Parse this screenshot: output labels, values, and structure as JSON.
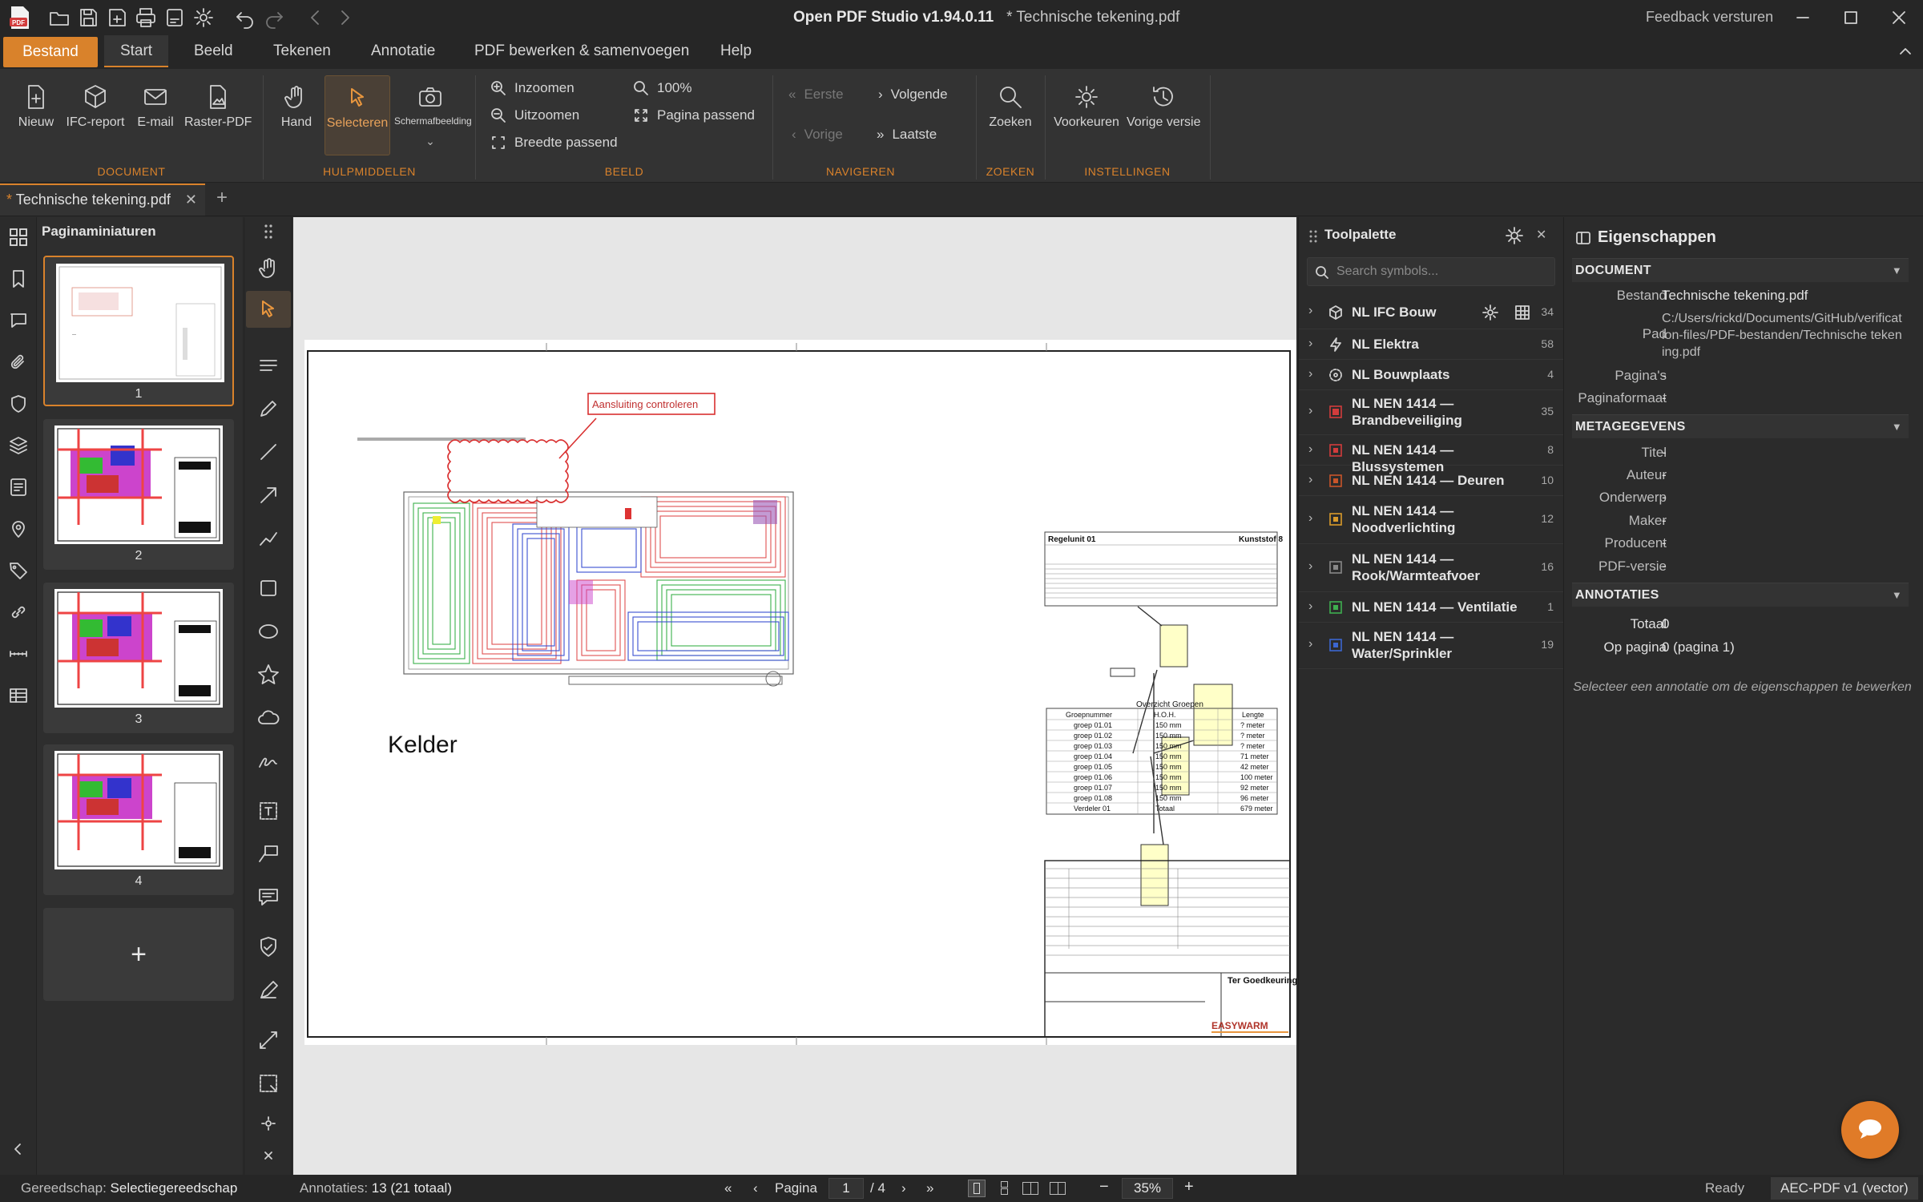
{
  "titlebar": {
    "app_title": "Open PDF Studio v1.94.0.11",
    "doc_title": "* Technische tekening.pdf",
    "feedback": "Feedback versturen"
  },
  "menu": {
    "items": [
      "Bestand",
      "Start",
      "Beeld",
      "Tekenen",
      "Annotatie",
      "PDF bewerken & samenvoegen",
      "Help"
    ]
  },
  "ribbon": {
    "document": {
      "group": "DOCUMENT",
      "nieuw": "Nieuw",
      "ifc": "IFC-report",
      "email": "E-mail",
      "raster": "Raster-PDF"
    },
    "hulp": {
      "group": "HULPMIDDELEN",
      "hand": "Hand",
      "select": "Selecteren",
      "screenshot": "Schermafbeelding"
    },
    "beeld": {
      "group": "BEELD",
      "zoomin": "Inzoomen",
      "zoomout": "Uitzoomen",
      "fitwidth": "Breedte passend",
      "zoom": "100%",
      "fitpage": "Pagina passend"
    },
    "nav": {
      "group": "NAVIGEREN",
      "first": "Eerste",
      "prev": "Vorige",
      "next": "Volgende",
      "last": "Laatste"
    },
    "zoeken": {
      "group": "ZOEKEN",
      "search": "Zoeken"
    },
    "instellingen": {
      "group": "INSTELLINGEN",
      "prefs": "Voorkeuren",
      "prev_version": "Vorige versie"
    }
  },
  "doctab": {
    "label": "Technische tekening.pdf",
    "modified": "*"
  },
  "thumbnails": {
    "title": "Paginaminiaturen",
    "pages": [
      "1",
      "2",
      "3",
      "4"
    ],
    "add": "+"
  },
  "drawing": {
    "label_kelder": "Kelder",
    "callout": "Aansluiting controleren",
    "title_block": "Ter Goedkeuring",
    "regelunit": "Regelunit 01",
    "kunststof": "Kunststof 8",
    "overzicht": "Overzicht Groepen",
    "groups_header": [
      "Groepnummer",
      "H.O.H.",
      "Lengte"
    ],
    "groups": [
      [
        "groep 01.01",
        "150 mm",
        "? meter"
      ],
      [
        "groep 01.02",
        "150 mm",
        "? meter"
      ],
      [
        "groep 01.03",
        "150 mm",
        "? meter"
      ],
      [
        "groep 01.04",
        "150 mm",
        "71 meter"
      ],
      [
        "groep 01.05",
        "150 mm",
        "42 meter"
      ],
      [
        "groep 01.06",
        "150 mm",
        "100 meter"
      ],
      [
        "groep 01.07",
        "150 mm",
        "92 meter"
      ],
      [
        "groep 01.08",
        "150 mm",
        "96 meter"
      ],
      [
        "Verdeler 01",
        "Totaal",
        "679 meter"
      ]
    ],
    "logo": "EASYWARM"
  },
  "toolpalette": {
    "title": "Toolpalette",
    "search_placeholder": "Search symbols...",
    "items": [
      {
        "name": "NL IFC Bouw",
        "count": "34",
        "color": "#d0d0d0"
      },
      {
        "name": "NL Elektra",
        "count": "58",
        "color": "#d0d0d0"
      },
      {
        "name": "NL Bouwplaats",
        "count": "4",
        "color": "#d0d0d0"
      },
      {
        "name": "NL NEN 1414 — Brandbeveiliging",
        "count": "35",
        "color": "#d23c3c"
      },
      {
        "name": "NL NEN 1414 — Blussystemen",
        "count": "8",
        "color": "#d23c3c"
      },
      {
        "name": "NL NEN 1414 — Deuren",
        "count": "10",
        "color": "#c8552a"
      },
      {
        "name": "NL NEN 1414 — Noodverlichting",
        "count": "12",
        "color": "#d99a2b"
      },
      {
        "name": "NL NEN 1414 — Rook/Warmteafvoer",
        "count": "16",
        "color": "#888888"
      },
      {
        "name": "NL NEN 1414 — Ventilatie",
        "count": "1",
        "color": "#3fae4f"
      },
      {
        "name": "NL NEN 1414 — Water/Sprinkler",
        "count": "19",
        "color": "#3b66d0"
      }
    ]
  },
  "properties": {
    "title": "Eigenschappen",
    "document": {
      "header": "DOCUMENT",
      "bestand_label": "Bestand",
      "bestand": "Technische tekening.pdf",
      "pad_label": "Pad",
      "pad": "C:/Users/rickd/Documents/GitHub/verification-files/PDF-bestanden/Technische tekening.pdf",
      "paginas_label": "Pagina's",
      "paginas": "-",
      "formaat_label": "Paginaformaat",
      "formaat": "-"
    },
    "meta": {
      "header": "METAGEGEVENS",
      "titel_label": "Titel",
      "titel": "-",
      "auteur_label": "Auteur",
      "auteur": "-",
      "onderwerp_label": "Onderwerp",
      "onderwerp": "-",
      "maker_label": "Maker",
      "maker": "-",
      "producent_label": "Producent",
      "producent": "-",
      "versie_label": "PDF-versie",
      "versie": "-"
    },
    "annot": {
      "header": "ANNOTATIES",
      "totaal_label": "Totaal",
      "totaal": "0",
      "oppagina_label": "Op pagina",
      "oppagina": "0 (pagina 1)",
      "hint": "Selecteer een annotatie om de eigenschappen te bewerken"
    }
  },
  "status": {
    "tool_label": "Gereedschap:",
    "tool": "Selectiegereedschap",
    "annot_label": "Annotaties:",
    "annot": "13 (21 totaal)",
    "page_label": "Pagina",
    "page": "1",
    "page_total": "/ 4",
    "zoom": "35%",
    "ready": "Ready",
    "mode": "AEC-PDF v1 (vector)"
  },
  "colors": {
    "accent": "#d9822b"
  }
}
